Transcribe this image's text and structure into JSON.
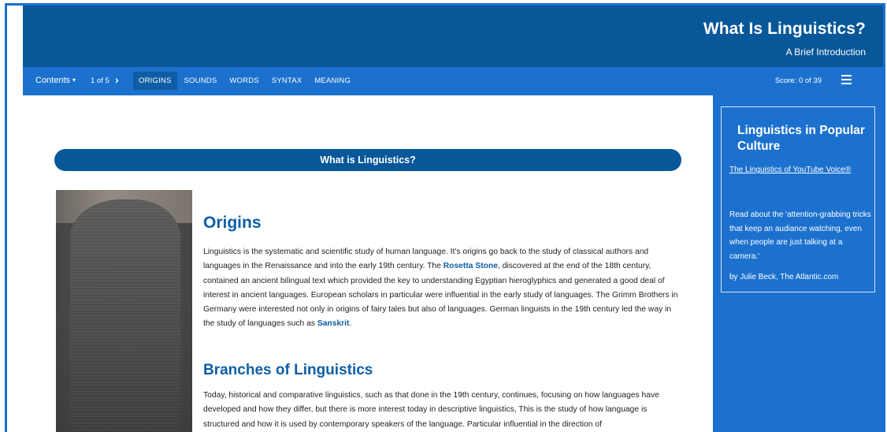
{
  "header": {
    "title": "What Is Linguistics?",
    "subtitle": "A Brief Introduction"
  },
  "nav": {
    "contents_label": "Contents",
    "contents_caret": "▾",
    "page_indicator": "1 of 5",
    "next_glyph": "›",
    "tabs": [
      {
        "label": "ORIGINS",
        "active": true
      },
      {
        "label": "SOUNDS",
        "active": false
      },
      {
        "label": "WORDS",
        "active": false
      },
      {
        "label": "SYNTAX",
        "active": false
      },
      {
        "label": "MEANING",
        "active": false
      }
    ],
    "score": "Score: 0 of 39",
    "menu_icon": "hamburger-menu-icon"
  },
  "main": {
    "banner": "What is Linguistics?",
    "image": "rosetta-stone-photo",
    "origins": {
      "heading": "Origins",
      "p1": "Linguistics is the systematic and scientific study of human language. It's origins go back to the study of classical authors and languages in the Renaissance and into the early 19th century. The ",
      "link1": "Rosetta Stone",
      "p2": ", discovered at the end of the 18th century, contained an ancient bilingual text which provided the key to understanding Egyptian hieroglyphics and generated a good deal of interest in ancient languages. European scholars in particular were influential in the early study of languages. The Grimm Brothers in Germany were interested not only in origins of fairy tales but also of languages. German linguists in the 19th century led the way in the study of languages such as ",
      "link2": "Sanskrit",
      "p3": "."
    },
    "branches": {
      "heading": "Branches of Linguistics",
      "text": "Today, historical and comparative linguistics, such as that done in the 19th century, continues, focusing on how languages have developed and how they differ, but there is more interest today in descriptive linguistics, This is the study of how language is structured and how it is used by contemporary speakers of the language. Particular influential in the direction of"
    }
  },
  "sidebar": {
    "title": "Linguistics in Popular Culture",
    "link": "The Linguistics of YouTube Voice®",
    "description": "Read about the 'attention-grabbing tricks that keep an audiance watching, even when people are just talking at a camera.'",
    "byline": "by Julie Beck, The Atlantic.com"
  },
  "colors": {
    "header_bg": "#075799",
    "nav_bg": "#1c71ce",
    "heading": "#0d5ea5"
  }
}
